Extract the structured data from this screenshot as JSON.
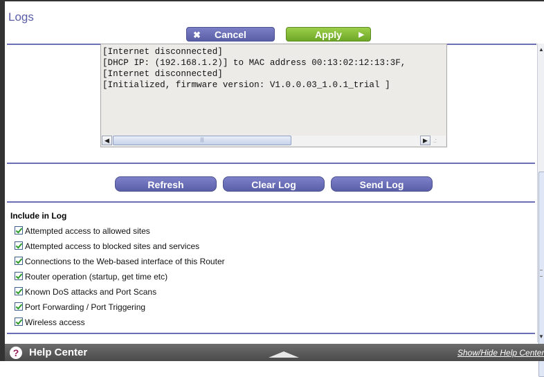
{
  "page": {
    "title": "Logs"
  },
  "toolbar": {
    "cancel_label": "Cancel",
    "apply_label": "Apply",
    "cancel_icon": "✖",
    "apply_icon": "▶"
  },
  "log": {
    "lines": "[Internet disconnected]\n[DHCP IP: (192.168.1.2)] to MAC address 00:13:02:12:13:3F,\n[Internet disconnected]\n[Initialized, firmware version: V1.0.0.03_1.0.1_trial ]"
  },
  "actions": {
    "refresh_label": "Refresh",
    "clear_label": "Clear Log",
    "send_label": "Send Log"
  },
  "include": {
    "title": "Include in Log",
    "options": [
      {
        "label": "Attempted access to allowed sites",
        "checked": true
      },
      {
        "label": "Attempted access to blocked sites and services",
        "checked": true
      },
      {
        "label": "Connections to the Web-based interface of this Router",
        "checked": true
      },
      {
        "label": "Router operation (startup, get time etc)",
        "checked": true
      },
      {
        "label": "Known DoS attacks and Port Scans",
        "checked": true
      },
      {
        "label": "Port Forwarding / Port Triggering",
        "checked": true
      },
      {
        "label": "Wireless access",
        "checked": true
      }
    ]
  },
  "footer": {
    "help_icon": "?",
    "help_title": "Help Center",
    "showhide_label": "Show/Hide Help Center"
  },
  "colors": {
    "accent": "#5a5fa8",
    "apply": "#7ab52f",
    "footer": "#555555"
  }
}
